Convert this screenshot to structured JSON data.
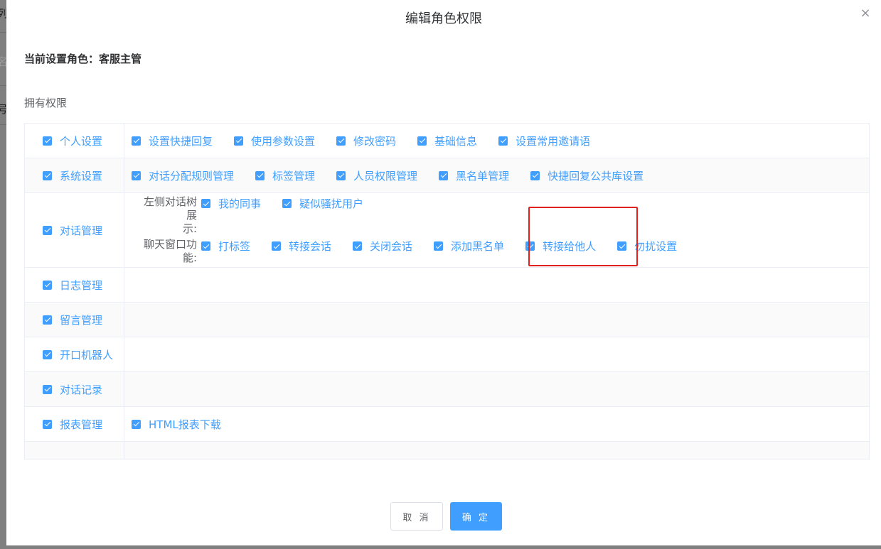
{
  "background": {
    "fragments": [
      "列",
      "名",
      "号"
    ]
  },
  "dialog": {
    "title": "编辑角色权限",
    "close_icon": "×",
    "role_label": "当前设置角色：客服主管",
    "section_label": "拥有权限",
    "cancel_label": "取 消",
    "confirm_label": "确 定"
  },
  "permissions": {
    "personal": {
      "label": "个人设置",
      "items": [
        "设置快捷回复",
        "使用参数设置",
        "修改密码",
        "基础信息",
        "设置常用邀请语"
      ]
    },
    "system": {
      "label": "系统设置",
      "items": [
        "对话分配规则管理",
        "标签管理",
        "人员权限管理",
        "黑名单管理",
        "快捷回复公共库设置"
      ]
    },
    "conversation": {
      "label": "对话管理",
      "left_tree_title_1": "左侧对话树展",
      "left_tree_title_2": "示:",
      "left_tree_items": [
        "我的同事",
        "疑似骚扰用户"
      ],
      "chat_window_title_1": "聊天窗口功",
      "chat_window_title_2": "能:",
      "chat_window_items": [
        "打标签",
        "转接会话",
        "关闭会话",
        "添加黑名单",
        "转接给他人",
        "勿扰设置"
      ]
    },
    "log": {
      "label": "日志管理"
    },
    "message": {
      "label": "留言管理"
    },
    "robot": {
      "label": "开口机器人"
    },
    "records": {
      "label": "对话记录"
    },
    "reports": {
      "label": "报表管理",
      "items": [
        "HTML报表下载"
      ]
    }
  },
  "colors": {
    "accent": "#409eff",
    "highlight_box": "#e0211d",
    "title_text": "#303133"
  }
}
